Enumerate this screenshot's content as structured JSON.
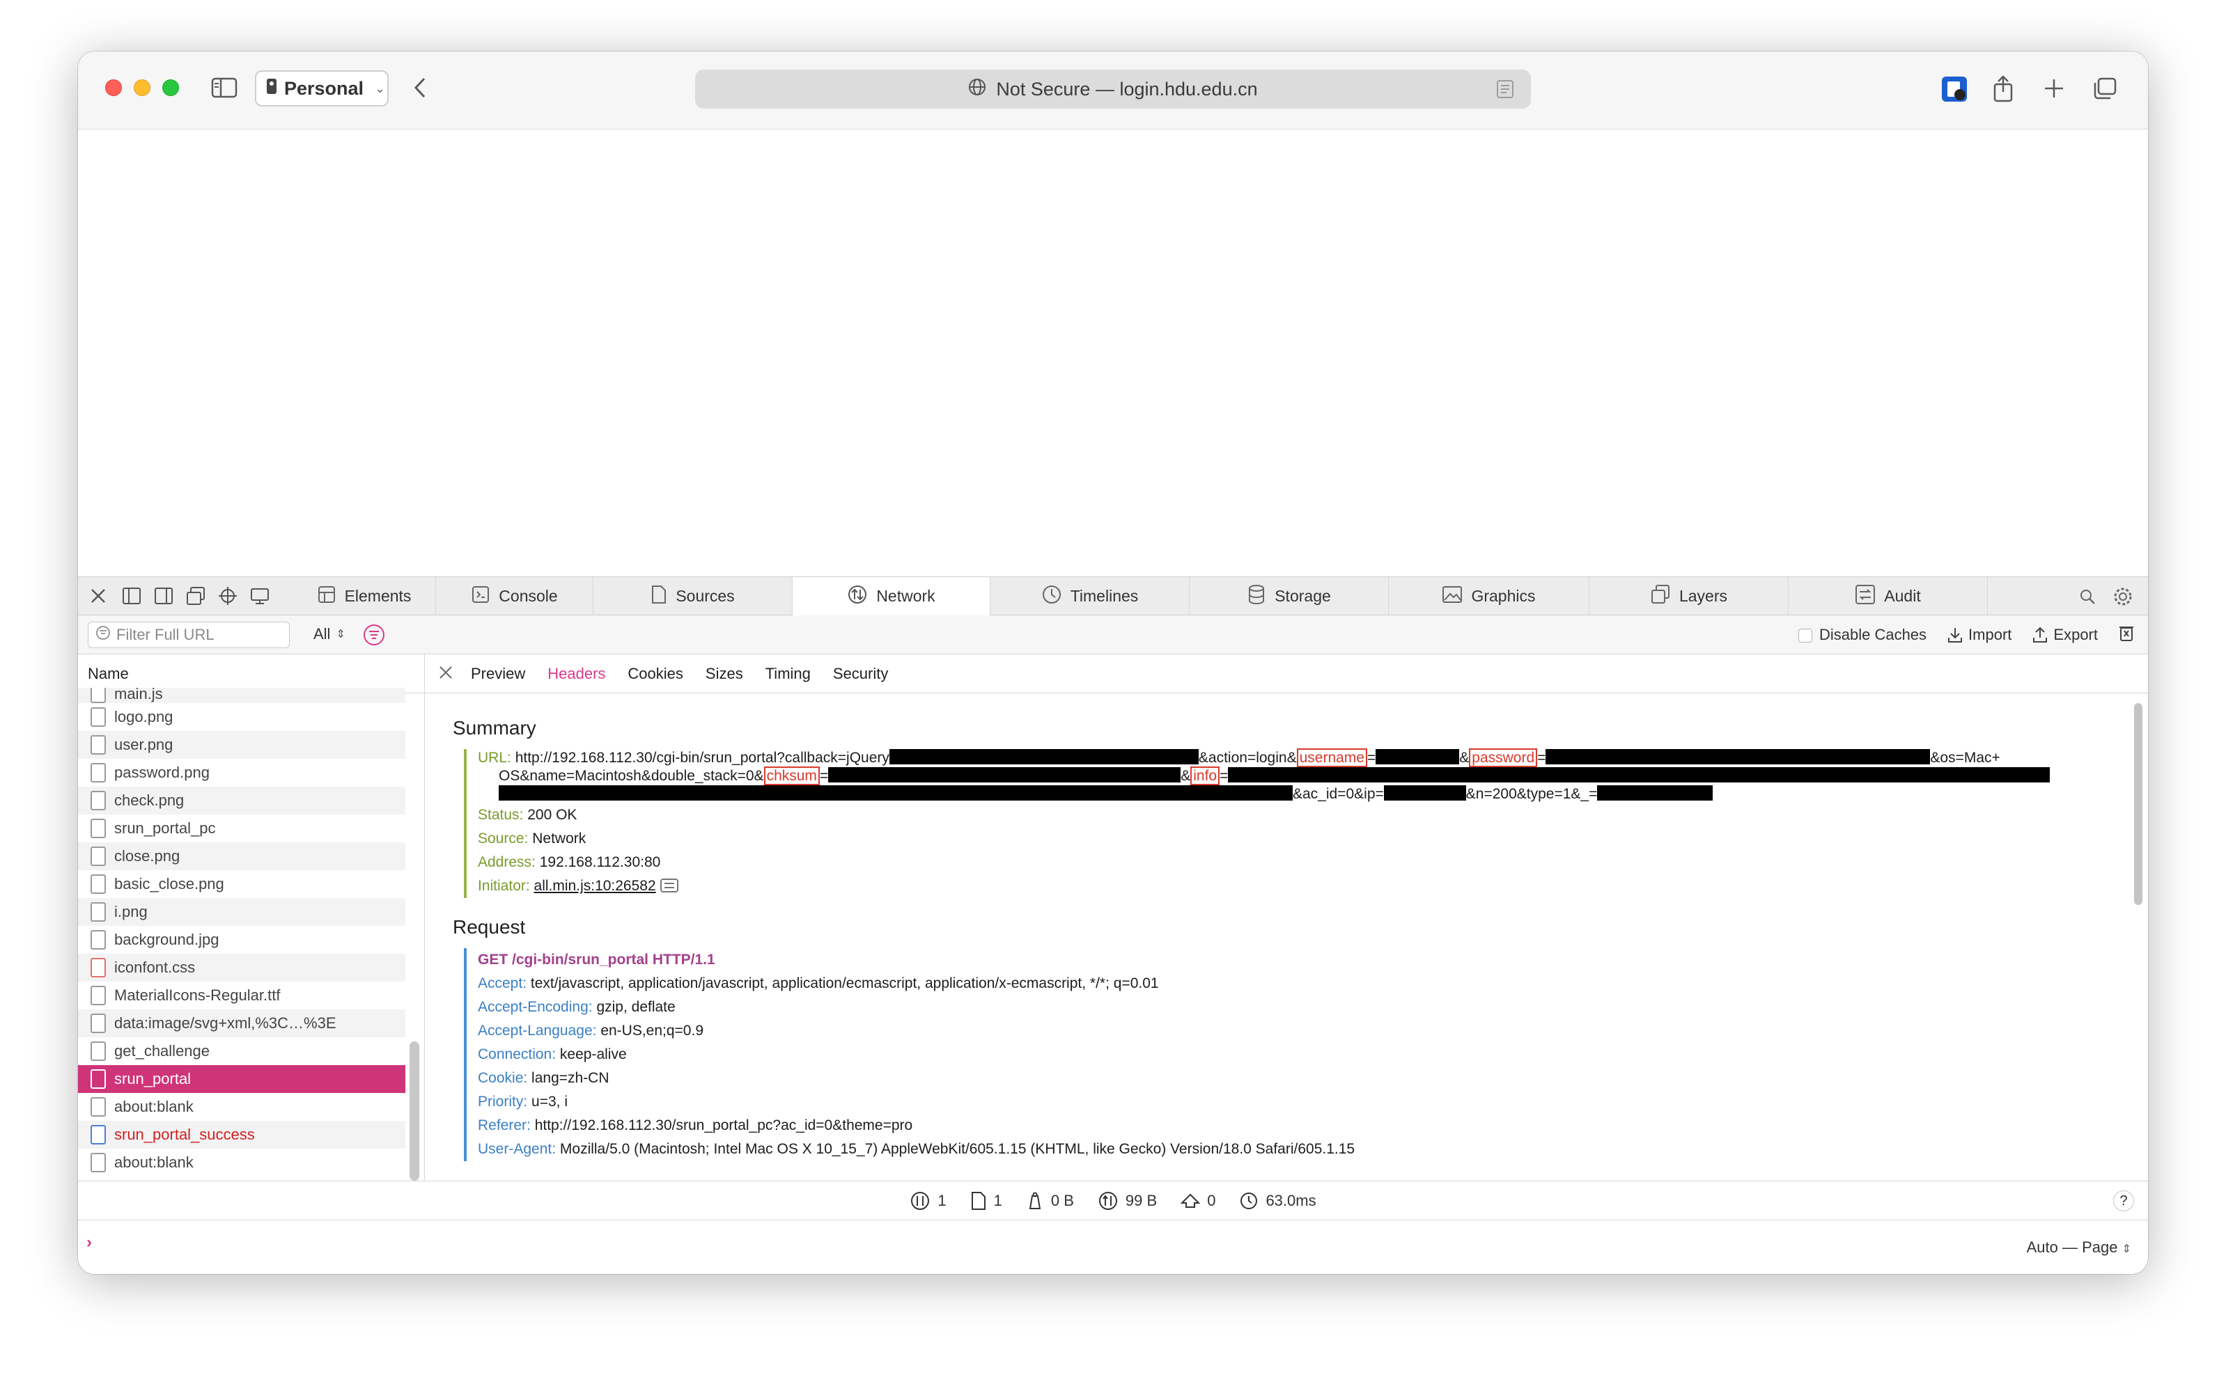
{
  "browser": {
    "profile": "Personal",
    "address": "Not Secure — login.hdu.edu.cn"
  },
  "devtools": {
    "tabs": [
      "Elements",
      "Console",
      "Sources",
      "Network",
      "Timelines",
      "Storage",
      "Graphics",
      "Layers",
      "Audit"
    ],
    "active_tab": "Network",
    "filter_placeholder": "Filter Full URL",
    "type_filter": "All",
    "disable_caches": "Disable Caches",
    "import": "Import",
    "export": "Export"
  },
  "sidebar": {
    "column_name": "Name",
    "items": [
      {
        "label": "main.js"
      },
      {
        "label": "logo.png"
      },
      {
        "label": "user.png"
      },
      {
        "label": "password.png"
      },
      {
        "label": "check.png"
      },
      {
        "label": "srun_portal_pc"
      },
      {
        "label": "close.png"
      },
      {
        "label": "basic_close.png"
      },
      {
        "label": "i.png"
      },
      {
        "label": "background.jpg"
      },
      {
        "label": "iconfont.css"
      },
      {
        "label": "MaterialIcons-Regular.ttf"
      },
      {
        "label": "data:image/svg+xml,%3C…%3E"
      },
      {
        "label": "get_challenge"
      },
      {
        "label": "srun_portal"
      },
      {
        "label": "about:blank"
      },
      {
        "label": "srun_portal_success"
      },
      {
        "label": "about:blank"
      }
    ]
  },
  "detail": {
    "tabs": [
      "Preview",
      "Headers",
      "Cookies",
      "Sizes",
      "Timing",
      "Security"
    ],
    "active_tab": "Headers",
    "summary_title": "Summary",
    "url_key": "URL:",
    "url_parts": {
      "p1": "http://192.168.112.30/cgi-bin/srun_portal?callback=jQuery",
      "p2": "&action=login&",
      "username": "username",
      "eq": "=",
      "amp": "&",
      "password": "password",
      "p3": "&os=Mac+",
      "p4": "OS&name=Macintosh&double_stack=0&",
      "chksum": "chksum",
      "info": "info",
      "p5": "&ac_id=0&ip=",
      "p6": "&n=200&type=1&_="
    },
    "summary": [
      {
        "key": "Status:",
        "value": "200 OK"
      },
      {
        "key": "Source:",
        "value": "Network"
      },
      {
        "key": "Address:",
        "value": "192.168.112.30:80"
      },
      {
        "key": "Initiator:",
        "value": "all.min.js:10:26582"
      }
    ],
    "request_title": "Request",
    "request_line": "GET /cgi-bin/srun_portal HTTP/1.1",
    "headers": [
      {
        "key": "Accept:",
        "value": "text/javascript, application/javascript, application/ecmascript, application/x-ecmascript, */*; q=0.01"
      },
      {
        "key": "Accept-Encoding:",
        "value": "gzip, deflate"
      },
      {
        "key": "Accept-Language:",
        "value": "en-US,en;q=0.9"
      },
      {
        "key": "Connection:",
        "value": "keep-alive"
      },
      {
        "key": "Cookie:",
        "value": "lang=zh-CN"
      },
      {
        "key": "Priority:",
        "value": "u=3, i"
      },
      {
        "key": "Referer:",
        "value": "http://192.168.112.30/srun_portal_pc?ac_id=0&theme=pro"
      },
      {
        "key": "User-Agent:",
        "value": "Mozilla/5.0 (Macintosh; Intel Mac OS X 10_15_7) AppleWebKit/605.1.15 (KHTML, like Gecko) Version/18.0 Safari/605.1.15"
      }
    ]
  },
  "statusbar": {
    "requests": "1",
    "resources": "1",
    "transferred": "0 B",
    "size": "99 B",
    "redirects": "0",
    "time": "63.0ms",
    "help": "?"
  },
  "console": {
    "mode": "Auto — Page"
  },
  "colors": {
    "accent": "#d83a8b",
    "selected_row": "#cf3479",
    "summary_key": "#7a9b2e",
    "header_key": "#3b7fc4",
    "highlight_box": "#d93a2e"
  }
}
